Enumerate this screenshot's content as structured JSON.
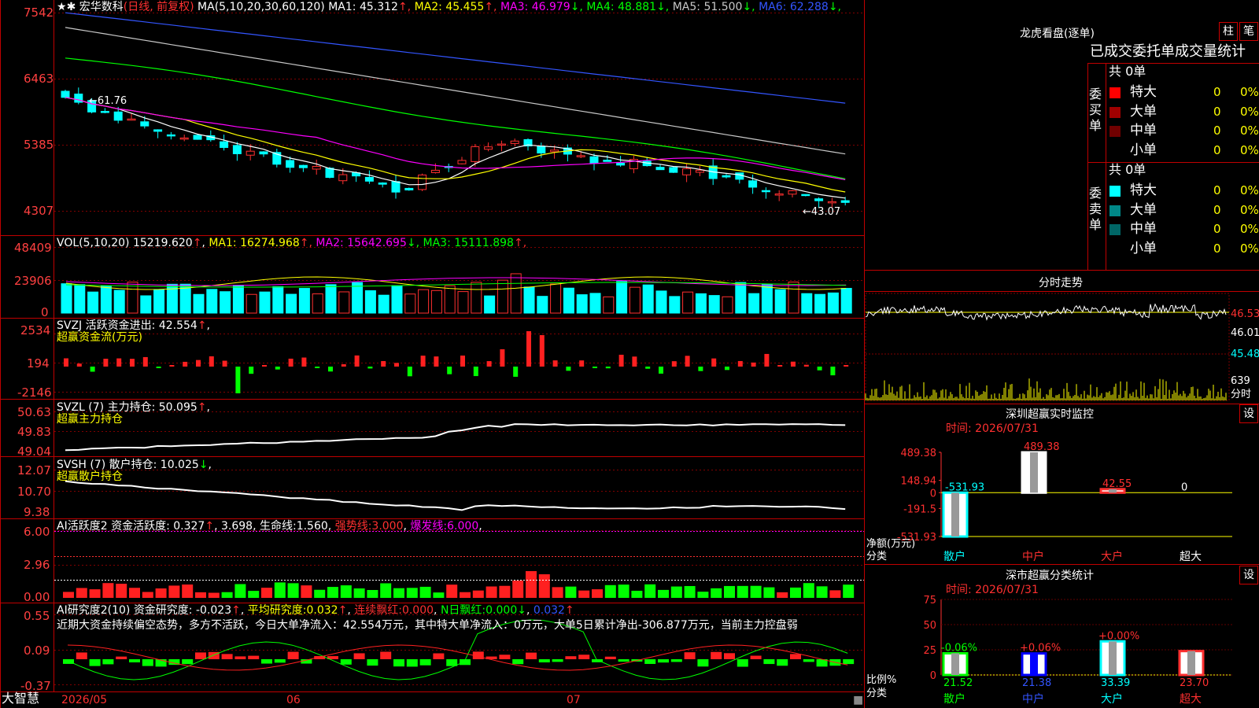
{
  "stock": {
    "name": "宏华数科",
    "mode": "(日线, 前复权)",
    "ma_label": "MA(5,10,20,30,60,120)",
    "ma": [
      {
        "label": "MA1:",
        "value": "45.312",
        "arrow": "↑",
        "color": "#ffffff"
      },
      {
        "label": "MA2:",
        "value": "45.455",
        "arrow": "↑",
        "color": "#ffff00"
      },
      {
        "label": "MA3:",
        "value": "46.979",
        "arrow": "↓",
        "color": "#ff00ff"
      },
      {
        "label": "MA4:",
        "value": "48.881",
        "arrow": "↓",
        "color": "#00ff00"
      },
      {
        "label": "MA5:",
        "value": "51.500",
        "arrow": "↓",
        "color": "#c8c8c8"
      },
      {
        "label": "MA6:",
        "value": "62.288",
        "arrow": "↓",
        "color": "#3355ff"
      }
    ],
    "price_axis": [
      "7542",
      "6463",
      "5385",
      "4307"
    ],
    "high_mark": "61.76",
    "low_mark": "43.07"
  },
  "vol": {
    "label": "VOL(5,10,20)",
    "value": "15219.620",
    "arrow": "↑",
    "ma": [
      {
        "label": "MA1:",
        "value": "16274.968",
        "arrow": "↑",
        "color": "#ffff00"
      },
      {
        "label": "MA2:",
        "value": "15642.695",
        "arrow": "↓",
        "color": "#ff00ff"
      },
      {
        "label": "MA3:",
        "value": "15111.898",
        "arrow": "↑",
        "color": "#00ff00"
      }
    ],
    "axis": [
      "48409",
      "23906",
      "0"
    ]
  },
  "svzj": {
    "label": "SVZJ",
    "name": "活跃资金进出:",
    "value": "42.554",
    "arrow": "↑",
    "sub": "超赢资金流(万元)",
    "axis": [
      "2534",
      "194",
      "-2146"
    ]
  },
  "svzl": {
    "label": "SVZL (7)",
    "name": "主力持仓:",
    "value": "50.095",
    "arrow": "↑",
    "sub": "超赢主力持仓",
    "axis": [
      "50.63",
      "49.83",
      "49.04"
    ]
  },
  "svsh": {
    "label": "SVSH (7)",
    "name": "散户持仓:",
    "value": "10.025",
    "arrow": "↓",
    "sub": "超赢散户持仓",
    "axis": [
      "12.07",
      "10.70",
      "9.38"
    ]
  },
  "ai1": {
    "label": "AI活跃度2",
    "name": "资金活跃度:",
    "value": "0.327",
    "arrow": "↑",
    "v2": "3.698",
    "life": "生命线:",
    "life_v": "1.560",
    "strong": "强势线:",
    "strong_v": "3.000",
    "burst": "爆发线:",
    "burst_v": "6.000",
    "axis": [
      "6.00",
      "2.96",
      "0.00"
    ]
  },
  "ai2": {
    "label": "AI研究度2(10)",
    "name": "资金研究度:",
    "value": "-0.023",
    "arrow": "↑",
    "avg": "平均研究度:",
    "avg_v": "0.032",
    "avg_arrow": "↑",
    "red": "连续飘红:",
    "red_v": "0.000",
    "nday": "N日飘红:",
    "nday_v": "0.000",
    "nday_arrow": "↓",
    "last": "0.032",
    "last_arrow": "↑",
    "comment": "近期大资金持续偏空态势，多方不活跃，今日大单净流入：42.554万元，其中特大单净流入：0万元，大单5日累计净出-306.877万元，当前主力控盘弱",
    "axis": [
      "0.55",
      "0.09",
      "-0.37"
    ]
  },
  "bottom": {
    "logo": "大智慧",
    "dates": [
      "2026/05",
      "06",
      "07"
    ]
  },
  "longhu": {
    "title": "龙虎看盘(逐单)",
    "btn1": "柱",
    "btn2": "笔",
    "header": "已成交委托单成交量统计",
    "buy_side": "委买单",
    "sell_side": "委卖单",
    "buy_total": "共 0单",
    "sell_total": "共 0单",
    "buy_rows": [
      {
        "name": "特大",
        "count": "0",
        "pct": "0%",
        "color": "#ff0000"
      },
      {
        "name": "大单",
        "count": "0",
        "pct": "0%",
        "color": "#a00000"
      },
      {
        "name": "中单",
        "count": "0",
        "pct": "0%",
        "color": "#700000"
      },
      {
        "name": "小单",
        "count": "0",
        "pct": "0%",
        "color": "#000000"
      }
    ],
    "sell_rows": [
      {
        "name": "特大",
        "count": "0",
        "pct": "0%",
        "color": "#00ffff"
      },
      {
        "name": "大单",
        "count": "0",
        "pct": "0%",
        "color": "#008888"
      },
      {
        "name": "中单",
        "count": "0",
        "pct": "0%",
        "color": "#006666"
      },
      {
        "name": "小单",
        "count": "0",
        "pct": "0%",
        "color": "#000000"
      }
    ]
  },
  "intraday": {
    "title": "分时走势",
    "axis": [
      "46.53",
      "46.01",
      "45.48"
    ],
    "vol_value": "639",
    "vol_unit": "分时"
  },
  "monitor": {
    "title": "深圳超赢实时监控",
    "btn": "设",
    "time": "时间: 2026/07/31",
    "axis": [
      "489.38",
      "148.94",
      "0",
      "-191.5",
      "-531.93"
    ],
    "ylabel": "净额(万元)",
    "xcat": "分类"
  },
  "classify": {
    "title": "深市超赢分类统计",
    "btn": "设",
    "time": "时间: 2026/07/31",
    "axis": [
      "75",
      "50",
      "25",
      "0"
    ],
    "ylabel": "比例%",
    "xcat": "分类"
  },
  "chart_data": [
    {
      "type": "bar",
      "title": "深圳超赢实时监控",
      "ylabel": "净额(万元)",
      "xlabel": "分类",
      "categories": [
        "散户",
        "中户",
        "大户",
        "超大"
      ],
      "values": [
        -531.93,
        489.38,
        42.55,
        0
      ],
      "value_labels": [
        "-531.93",
        "489.38",
        "42.55",
        "0"
      ],
      "ylim": [
        -531.93,
        489.38
      ],
      "colors": [
        "#00ffff",
        "#ffffff",
        "#ff3030",
        "#ffff00"
      ]
    },
    {
      "type": "bar",
      "title": "深市超赢分类统计",
      "ylabel": "比例%",
      "xlabel": "分类",
      "categories": [
        "散户",
        "中户",
        "大户",
        "超大"
      ],
      "values": [
        21.52,
        21.38,
        33.39,
        23.7
      ],
      "value_labels": [
        "21.52",
        "21.38",
        "33.39",
        "23.70"
      ],
      "changes": [
        "-0.06%",
        "+0.06%",
        "+0.00%",
        ""
      ],
      "ylim": [
        0,
        75
      ],
      "colors": [
        "#00ff00",
        "#0000ff",
        "#00ffff",
        "#ff3030"
      ]
    }
  ]
}
